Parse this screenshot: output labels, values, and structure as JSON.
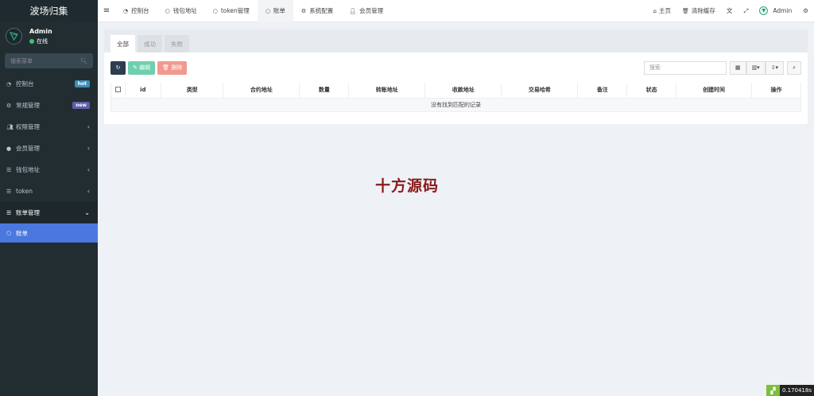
{
  "sidebar": {
    "brand": "波场归集",
    "user": {
      "name": "Admin",
      "status": "在线"
    },
    "search_placeholder": "搜索菜单",
    "items": [
      {
        "icon": "dashboard-icon",
        "label": "控制台",
        "badge": "hot"
      },
      {
        "icon": "cogs-icon",
        "label": "常规管理",
        "badge": "new"
      },
      {
        "icon": "users-icon",
        "label": "权限管理"
      },
      {
        "icon": "user-circle-icon",
        "label": "会员管理"
      },
      {
        "icon": "list-icon",
        "label": "钱包地址"
      },
      {
        "icon": "list-icon",
        "label": "token"
      },
      {
        "icon": "list-icon",
        "label": "账单管理"
      }
    ],
    "active_sub": "账单"
  },
  "topbar": {
    "tabs": [
      {
        "icon": "dashboard-icon",
        "label": "控制台"
      },
      {
        "icon": "circle-icon",
        "label": "钱包地址"
      },
      {
        "icon": "circle-icon",
        "label": "token管理"
      },
      {
        "icon": "circle-icon",
        "label": "账单"
      },
      {
        "icon": "gear-icon",
        "label": "系统配置"
      },
      {
        "icon": "user-icon",
        "label": "会员管理"
      }
    ],
    "home": "主页",
    "clear_cache": "清除缓存",
    "admin": "Admin"
  },
  "panel": {
    "tabs": [
      "全部",
      "成功",
      "失败"
    ],
    "buttons": {
      "edit": "编辑",
      "delete": "删除"
    },
    "search_placeholder": "搜索",
    "columns": [
      "id",
      "类型",
      "合约地址",
      "数量",
      "转账地址",
      "收款地址",
      "交易哈希",
      "备注",
      "状态",
      "创建时间",
      "操作"
    ],
    "empty_text": "没有找到匹配的记录"
  },
  "watermark": "十方源码",
  "timer": "0.170418s"
}
